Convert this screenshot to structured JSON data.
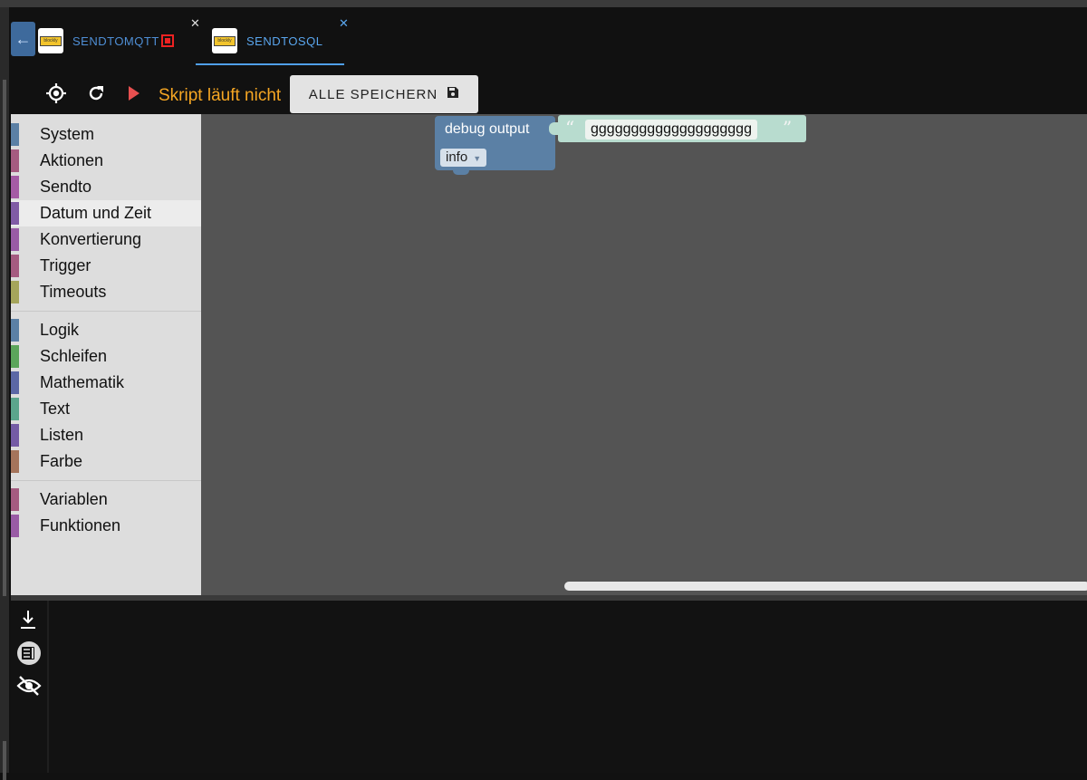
{
  "tabs": [
    {
      "label": "SENDTOMQTT",
      "logo_text": "blockly",
      "close": "✕",
      "running": true
    },
    {
      "label": "SENDTOSQL",
      "logo_text": "blockly",
      "close": "✕",
      "running": false
    }
  ],
  "toolbar": {
    "status_text": "Skript läuft nicht",
    "save_label": "ALLE SPEICHERN"
  },
  "toolbox": {
    "groups": [
      [
        {
          "label": "System",
          "color": "#5b80a5"
        },
        {
          "label": "Aktionen",
          "color": "#a55b80"
        },
        {
          "label": "Sendto",
          "color": "#a55ba5"
        },
        {
          "label": "Datum und Zeit",
          "color": "#805ba5"
        },
        {
          "label": "Konvertierung",
          "color": "#995ba5"
        },
        {
          "label": "Trigger",
          "color": "#a55b80"
        },
        {
          "label": "Timeouts",
          "color": "#a5a55b"
        }
      ],
      [
        {
          "label": "Logik",
          "color": "#5b80a5"
        },
        {
          "label": "Schleifen",
          "color": "#5ba55b"
        },
        {
          "label": "Mathematik",
          "color": "#5b67a5"
        },
        {
          "label": "Text",
          "color": "#5ba58c"
        },
        {
          "label": "Listen",
          "color": "#745ba5"
        },
        {
          "label": "Farbe",
          "color": "#a5745b"
        }
      ],
      [
        {
          "label": "Variablen",
          "color": "#a55b80"
        },
        {
          "label": "Funktionen",
          "color": "#995ba5"
        }
      ]
    ]
  },
  "blocks": {
    "debug_title": "debug output",
    "debug_level": "info",
    "text_open_quote": "“",
    "text_close_quote": "”",
    "text_value": "gggggggggggggggggggg"
  },
  "colors": {
    "accent": "#4f9fe8",
    "status": "#f5a623",
    "play": "#e85050",
    "block_debug": "#5b80a5",
    "block_text": "#b8dccf"
  }
}
